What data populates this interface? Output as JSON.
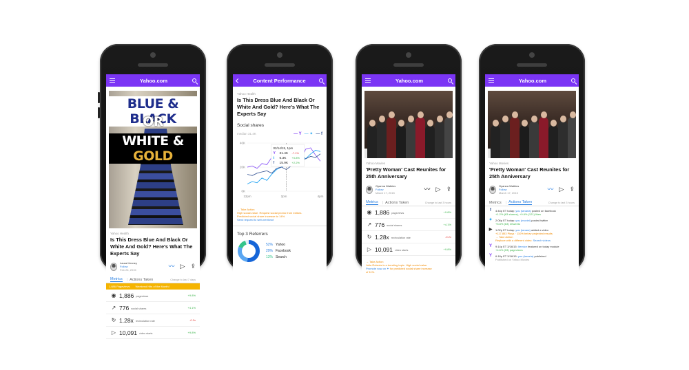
{
  "app": {
    "title": "Yahoo.com",
    "perf_title": "Content Performance"
  },
  "colors": {
    "accent": "#7b35f5",
    "link": "#2b80e2",
    "positive": "#3cb44b",
    "negative": "#e53935",
    "warning": "#f5b400"
  },
  "dress_article": {
    "source": "Yahoo Health",
    "headline": "Is This Dress Blue And Black Or White And Gold? Here's What The Experts Say",
    "image_text": {
      "line1": "BLUE & BLACK",
      "line2": "OR",
      "line3a": "WHITE & ",
      "line3b": "GOLD"
    },
    "author": "Laura Kenney",
    "follow": "Follow",
    "date": "Feb 26, 2015"
  },
  "dress_metrics": {
    "tab_metrics": "Metrics",
    "tab_actions": "Actions Taken",
    "hint": "Change to last 7 days",
    "banner_a": "1,886 Pageviews",
    "banner_b": "Weekend Hits of the Month!",
    "rows": [
      {
        "value": "1,886",
        "label": "pageviews",
        "delta": "+9.8%"
      },
      {
        "value": "776",
        "label": "social shares",
        "delta": "+4.1%"
      },
      {
        "value": "1.28x",
        "label": "recirculation rate",
        "delta": "-0.2x"
      },
      {
        "value": "10,091",
        "label": "video starts",
        "delta": "+9.8%"
      }
    ]
  },
  "perf": {
    "source": "Yahoo Health",
    "headline": "Is This Dress Blue And Black Or White And Gold? Here's What The Experts Say",
    "social_heading": "Social shares",
    "legend_median": "median 31.4K",
    "tooltip": {
      "date": "02/14/15, 1pm",
      "rows": [
        {
          "src": "Y",
          "value": "31.4K",
          "delta": "-7.1%"
        },
        {
          "src": "t",
          "value": "6.3K",
          "delta": "+0.8%"
        },
        {
          "src": "f",
          "value": "15.9K",
          "delta": "+2.2%"
        }
      ]
    },
    "note_action": "Take Action",
    "note_line1": "High social value. Request social promo from editors.",
    "note_line2": "Predicted social share increase to 14%.",
    "note_link": "Send request to web-nextknot",
    "referrers_heading": "Top 3 Referrers",
    "referrers": [
      {
        "pct": "52%",
        "name": "Yahoo"
      },
      {
        "pct": "29%",
        "name": "Facebook"
      },
      {
        "pct": "13%",
        "name": "Search"
      }
    ]
  },
  "chart_data": {
    "type": "line",
    "x": [
      "12pm",
      "2pm",
      "4pm"
    ],
    "ylim": [
      0,
      40
    ],
    "yticks": [
      "0K",
      "20K",
      "40K"
    ],
    "series": [
      {
        "name": "Yahoo",
        "values": [
          20,
          21,
          19,
          23,
          22,
          28,
          26,
          30,
          33,
          37,
          29,
          27,
          35,
          36,
          30,
          25
        ]
      },
      {
        "name": "Twitter",
        "values": [
          6,
          8,
          7,
          11,
          9,
          14,
          18,
          20,
          22,
          24,
          26,
          30,
          27,
          31,
          34,
          33
        ]
      },
      {
        "name": "Facebook",
        "values": [
          14,
          13,
          15,
          16,
          17,
          15,
          19,
          20,
          18,
          21,
          24,
          26,
          27,
          29,
          28,
          31
        ]
      }
    ]
  },
  "pw_article": {
    "source": "Yahoo Movies",
    "headline": "'Pretty Woman' Cast Reunites for 25th Anniversary",
    "author": "Gyanna Watkins",
    "follow": "Follow",
    "date": "March 17, 2015"
  },
  "pw_metrics": {
    "tab_metrics": "Metrics",
    "tab_actions": "Actions Taken",
    "hint": "Change to last 3 hours",
    "rows": [
      {
        "value": "1,886",
        "label": "pageviews",
        "delta": "+9.8%"
      },
      {
        "value": "776",
        "label": "social shares",
        "delta": "+4.1%"
      },
      {
        "value": "1.28x",
        "label": "recirculation rate",
        "delta": "-0.2x"
      },
      {
        "value": "10,091",
        "label": "video starts",
        "delta": "+9.8%"
      }
    ],
    "note_action": "Take Action",
    "note_line1": "Julia Roberts is a trending topic. High social value.",
    "note_line2a": "Promote now on",
    "note_line2b": "for predicted social share increase",
    "note_line3": "of 11%."
  },
  "pw_actions": {
    "tab_metrics": "Metrics",
    "tab_actions": "Actions Taken",
    "hint": "Change to last 3 hours",
    "feed": [
      {
        "icon": "f",
        "line1a": "4:44p ET today:",
        "line1b": "you (tanaria)",
        "line1c": "posted on facebook",
        "line2": "+1.2% (63 shares), +9.6% (121) likes"
      },
      {
        "icon": "t",
        "line1a": "2:06p ET today:",
        "line1b": "you (moviei)",
        "line1c": "posted twitter",
        "line2": "+5.8% (63) retweets"
      },
      {
        "icon": "▶",
        "line1a": "1:02p ET today:",
        "line1b": "you (tanara)",
        "line1c": "added a video",
        "line2": "+117,853 Plays · 110% below projected results",
        "line3": "Take Action",
        "line4": "Replace with a different video:",
        "line4b": "Search videos"
      },
      {
        "icon": "Y",
        "line1a": "9:14p ET 3/16/15:",
        "line1b": "Iternice",
        "line1c": "featured on today module",
        "line2": "+4.6% (53) pageviews"
      },
      {
        "icon": "Y",
        "line1a": "6:18p ET 3/16/15:",
        "line1b": "you (tanaria)",
        "line1c": "published",
        "line2": "Published on Yahoo Movies"
      }
    ]
  }
}
